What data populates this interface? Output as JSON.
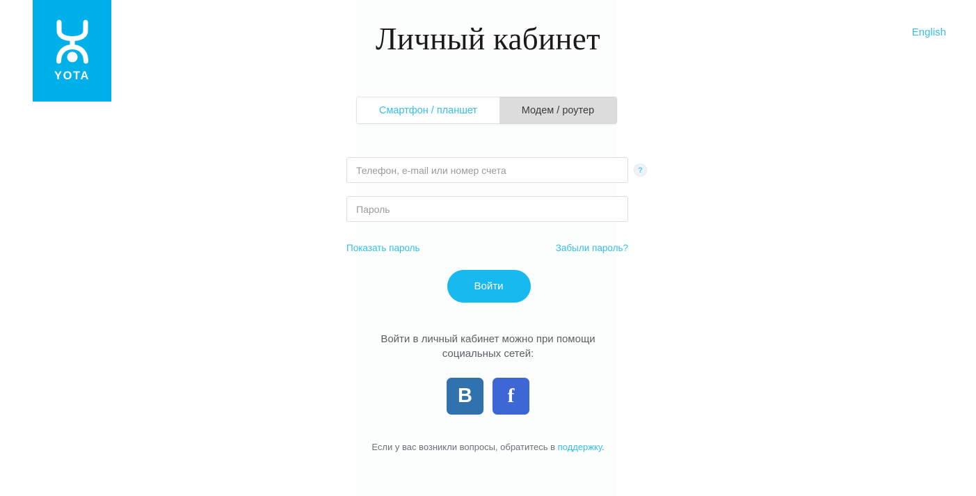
{
  "brand": {
    "wordmark": "YOTA",
    "logo_icon": "yota-figure-icon",
    "brand_color": "#00b0e8"
  },
  "header": {
    "title": "Личный кабинет",
    "language_link": "English"
  },
  "tabs": [
    {
      "label": "Смартфон / планшет",
      "active": true
    },
    {
      "label": "Модем / роутер",
      "active": false
    }
  ],
  "form": {
    "login": {
      "placeholder": "Телефон, e-mail или номер счета",
      "value": ""
    },
    "password": {
      "placeholder": "Пароль",
      "value": ""
    },
    "help_icon": "?",
    "show_password_link": "Показать пароль",
    "forgot_password_link": "Забыли пароль?",
    "submit_label": "Войти",
    "accent_color": "#18b9ef"
  },
  "social": {
    "prompt_line1": "Войти в личный кабинет можно при помощи",
    "prompt_line2": "социальных сетей:",
    "buttons": [
      {
        "name": "vkontakte",
        "glyph": "В",
        "color": "#2f72ae"
      },
      {
        "name": "facebook",
        "glyph": "f",
        "color": "#3d67d4"
      }
    ]
  },
  "footer": {
    "text_before": "Если у вас возникли вопросы, обратитесь в ",
    "link_label": "поддержку",
    "text_after": "."
  }
}
